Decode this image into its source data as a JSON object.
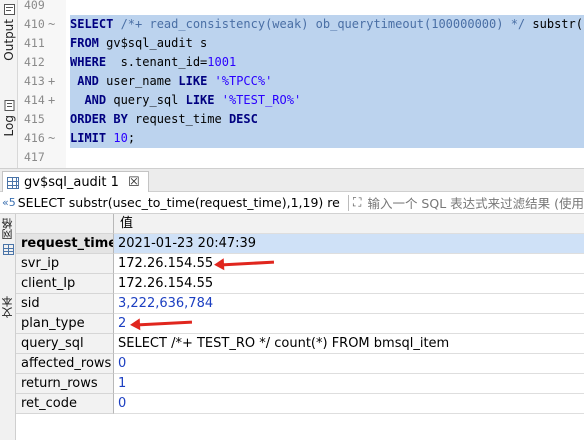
{
  "side_tabs": {
    "output": "Output",
    "log": "Log"
  },
  "editor": {
    "lines": [
      {
        "n": "409",
        "highlight": false,
        "parts": []
      },
      {
        "n": "410",
        "fold": "~",
        "highlight": true,
        "parts": [
          {
            "t": "kw",
            "v": "SELECT "
          },
          {
            "t": "cm",
            "v": "/*+ read_consistency(weak) ob_querytimeout(100000000) */ "
          },
          {
            "t": "",
            "v": "substr("
          }
        ]
      },
      {
        "n": "411",
        "highlight": true,
        "parts": [
          {
            "t": "kw",
            "v": "FROM "
          },
          {
            "t": "",
            "v": "gv$sql_audit s"
          }
        ]
      },
      {
        "n": "412",
        "highlight": true,
        "parts": [
          {
            "t": "kw",
            "v": "WHERE "
          },
          {
            "t": "",
            "v": " s.tenant_id="
          },
          {
            "t": "num",
            "v": "1001"
          }
        ]
      },
      {
        "n": "413",
        "fold": "+",
        "highlight": true,
        "parts": [
          {
            "t": "",
            "v": " "
          },
          {
            "t": "kw",
            "v": "AND "
          },
          {
            "t": "",
            "v": "user_name "
          },
          {
            "t": "kw",
            "v": "LIKE "
          },
          {
            "t": "str",
            "v": "'%TPCC%'"
          }
        ]
      },
      {
        "n": "414",
        "fold": "+",
        "highlight": true,
        "parts": [
          {
            "t": "",
            "v": "  "
          },
          {
            "t": "kw",
            "v": "AND "
          },
          {
            "t": "",
            "v": "query_sql "
          },
          {
            "t": "kw",
            "v": "LIKE "
          },
          {
            "t": "str",
            "v": "'%TEST_RO%'"
          }
        ]
      },
      {
        "n": "415",
        "highlight": true,
        "parts": [
          {
            "t": "kw",
            "v": "ORDER BY "
          },
          {
            "t": "",
            "v": "request_time "
          },
          {
            "t": "kw",
            "v": "DESC"
          }
        ]
      },
      {
        "n": "416",
        "fold": "~",
        "highlight": true,
        "parts": [
          {
            "t": "kw",
            "v": "LIMIT "
          },
          {
            "t": "num",
            "v": "10"
          },
          {
            "t": "",
            "v": ";"
          }
        ]
      },
      {
        "n": "417",
        "highlight": false,
        "parts": []
      }
    ]
  },
  "result_tab": {
    "label": "gv$sql_audit 1",
    "close": "☒"
  },
  "query_bar": {
    "sql_text": "SELECT substr(usec_to_time(request_time),1,19) re",
    "filter_placeholder": "输入一个 SQL 表达式来过滤结果 (使用"
  },
  "grid_strip": {
    "grid_label": "网格",
    "text_label": "文本"
  },
  "record": {
    "header": {
      "name": "",
      "value": "值"
    },
    "rows": [
      {
        "name": "request_time_",
        "value": "2021-01-23 20:47:39",
        "kind": "text",
        "selected": true,
        "arrow": false
      },
      {
        "name": "svr_ip",
        "value": "172.26.154.55",
        "kind": "text",
        "selected": false,
        "arrow": true
      },
      {
        "name": "client_Ip",
        "value": "172.26.154.55",
        "kind": "text",
        "selected": false,
        "arrow": false
      },
      {
        "name": "sid",
        "value": "3,222,636,784",
        "kind": "number",
        "selected": false,
        "arrow": false
      },
      {
        "name": "plan_type",
        "value": "2",
        "kind": "number",
        "selected": false,
        "arrow": true
      },
      {
        "name": "query_sql",
        "value": "SELECT /*+ TEST_RO */ count(*) FROM bmsql_item",
        "kind": "text",
        "selected": false,
        "arrow": false
      },
      {
        "name": "affected_rows",
        "value": "0",
        "kind": "number",
        "selected": false,
        "arrow": false
      },
      {
        "name": "return_rows",
        "value": "1",
        "kind": "number",
        "selected": false,
        "arrow": false
      },
      {
        "name": "ret_code",
        "value": "0",
        "kind": "number",
        "selected": false,
        "arrow": false
      }
    ]
  },
  "colors": {
    "selection": "#bcd3ee",
    "keyword": "#000080",
    "string": "#2a00ff",
    "annotation_arrow": "#e0261e"
  }
}
